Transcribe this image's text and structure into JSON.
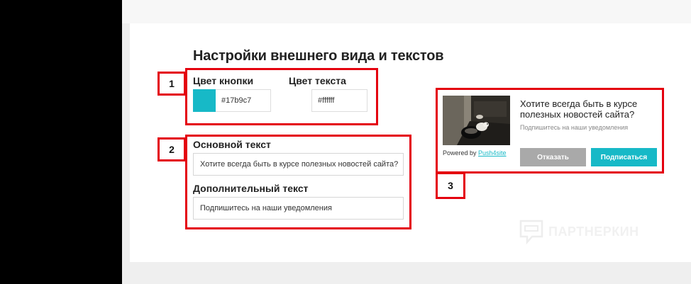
{
  "page": {
    "title": "Настройки внешнего вида и текстов"
  },
  "colors": {
    "button_label": "Цвет кнопки",
    "button_hex": "#17b9c7",
    "text_label": "Цвет текста",
    "text_hex": "#ffffff",
    "accent": "#17b9c7",
    "annotation_red": "#e4000f",
    "decline_gray": "#a9a9a9"
  },
  "texts": {
    "main_label": "Основной текст",
    "main_value": "Хотите всегда быть в курсе полезных новостей сайта?",
    "extra_label": "Дополнительный текст",
    "extra_value": "Подпишитесь на наши уведомления"
  },
  "preview": {
    "title": "Хотите всегда быть в курсе полезных новостей сайта?",
    "subtitle": "Подпишитесь на наши уведомления",
    "powered_prefix": "Powered by ",
    "powered_link": "Push4site",
    "decline": "Отказать",
    "subscribe": "Подписаться",
    "image_icon": "rodent-photo-icon"
  },
  "annotations": {
    "n1": "1",
    "n2": "2",
    "n3": "3"
  },
  "watermark": {
    "text": "ПАРТНЕРКИН",
    "icon": "chat-bubble-icon"
  }
}
